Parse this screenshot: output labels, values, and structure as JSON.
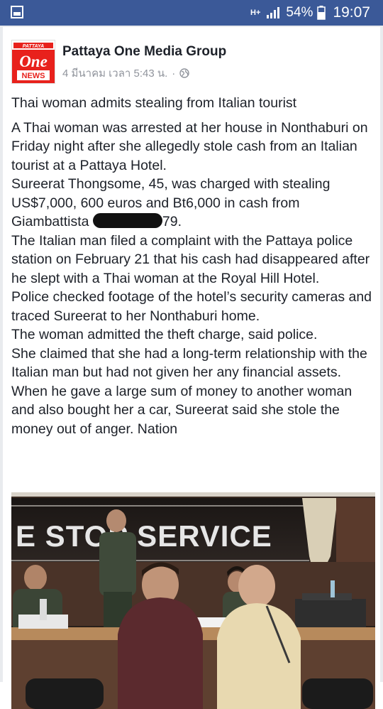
{
  "status_bar": {
    "network": "H+",
    "battery": "54%",
    "time": "19:07"
  },
  "post": {
    "page_name": "Pattaya One Media Group",
    "timestamp": "4 มีนาคม เวลา 5:43 น.",
    "separator": "·",
    "logo": {
      "brand_small": "PATTAYA",
      "brand_main": "One",
      "brand_tag": "NEWS"
    },
    "headline": "Thai woman admits stealing from Italian tourist",
    "paragraphs": [
      "A Thai woman was arrested at her house in Nonthaburi on Friday night after she allegedly stole cash from an Italian tourist at a Pattaya Hotel.",
      "Sureerat Thongsome, 45, was charged with stealing US$7,000, 600 euros and Bt6,000 in cash from Giambattista",
      "79.",
      "The Italian man filed a complaint with the Pattaya police station on February 21 that his cash had disappeared after he slept with a Thai woman at the Royal Hill Hotel.",
      "Police checked footage of the hotel’s security cameras and traced Sureerat to her Nonthaburi home.",
      "The woman admitted the theft charge, said police.",
      "She claimed that she had a long-term relationship with the Italian man but had not given her any financial assets.",
      "When he gave a large sum of money to another woman and also bought her a car, Sureerat said she stole the money out of anger. Nation"
    ],
    "photo_sign_text": "E STOP SERVICE"
  },
  "colors": {
    "status_bar_bg": "#3b5998",
    "feed_bg": "#e9ebee",
    "logo_red": "#e8211c"
  }
}
